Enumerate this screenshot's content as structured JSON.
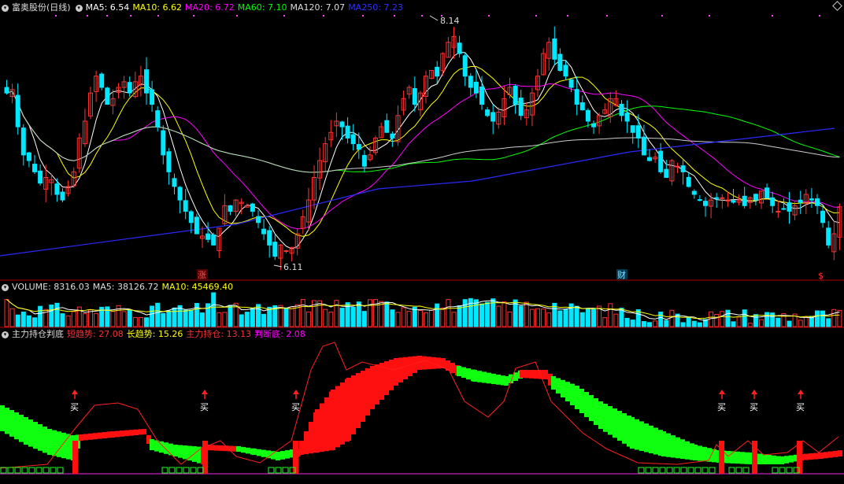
{
  "header": {
    "title": "富奥股份(日线)",
    "ma": [
      {
        "label": "MA5: 6.54",
        "color": "#ffffff"
      },
      {
        "label": "MA10: 6.62",
        "color": "#ffff00"
      },
      {
        "label": "MA20: 6.72",
        "color": "#ff00ff"
      },
      {
        "label": "MA60: 7.10",
        "color": "#00ff00"
      },
      {
        "label": "MA120: 7.07",
        "color": "#dddddd"
      },
      {
        "label": "MA250: 7.23",
        "color": "#3030ff"
      }
    ]
  },
  "volume_header": {
    "label": "VOLUME: 8316.03",
    "ma5": "MA5: 38126.72",
    "ma10": "MA10: 45469.40"
  },
  "indicator_header": {
    "title": "主力持仓判底",
    "items": [
      {
        "label": "短趋势: 27.08",
        "color": "#ff3030"
      },
      {
        "label": "长趋势: 15.26",
        "color": "#ffff00"
      },
      {
        "label": "主力持仓: 13.13",
        "color": "#ff3030"
      },
      {
        "label": "判断底: 2.08",
        "color": "#ff00ff"
      }
    ]
  },
  "annotations": {
    "high": "8.14",
    "low": "6.11",
    "marker_zhang": "涨",
    "marker_cai": "财",
    "marker_dollar": "$",
    "buy": "买"
  },
  "colors": {
    "up": "#ff3232",
    "down": "#00e8ff",
    "bull": "#ff1010",
    "bear": "#10ff10"
  },
  "chart_data": {
    "type": "candlestick",
    "price_range": [
      6.11,
      8.14
    ],
    "closes": [
      7.55,
      7.58,
      7.25,
      7.0,
      6.95,
      6.85,
      6.75,
      6.8,
      6.78,
      6.65,
      6.6,
      6.72,
      6.85,
      7.15,
      7.3,
      7.55,
      7.7,
      7.6,
      7.45,
      7.5,
      7.6,
      7.65,
      7.55,
      7.65,
      7.7,
      7.55,
      7.45,
      7.25,
      7.0,
      6.85,
      6.72,
      6.6,
      6.5,
      6.4,
      6.3,
      6.28,
      6.25,
      6.2,
      6.35,
      6.55,
      6.5,
      6.6,
      6.58,
      6.55,
      6.5,
      6.4,
      6.3,
      6.2,
      6.1,
      6.2,
      6.15,
      6.18,
      6.3,
      6.45,
      6.6,
      6.8,
      6.95,
      7.1,
      7.2,
      7.3,
      7.25,
      7.15,
      7.1,
      7.05,
      6.9,
      7.0,
      7.15,
      7.25,
      7.2,
      7.15,
      7.35,
      7.5,
      7.6,
      7.45,
      7.55,
      7.7,
      7.75,
      7.7,
      7.9,
      8.0,
      8.05,
      7.9,
      7.7,
      7.6,
      7.55,
      7.45,
      7.35,
      7.3,
      7.38,
      7.5,
      7.6,
      7.45,
      7.35,
      7.4,
      7.55,
      7.7,
      7.9,
      8.0,
      7.85,
      7.75,
      7.7,
      7.6,
      7.45,
      7.4,
      7.3,
      7.25,
      7.35,
      7.4,
      7.5,
      7.5,
      7.35,
      7.3,
      7.2,
      7.15,
      7.0,
      6.95,
      6.98,
      6.85,
      6.8,
      6.95,
      6.9,
      6.85,
      6.72,
      6.65,
      6.6,
      6.55,
      6.6,
      6.62,
      6.62,
      6.6,
      6.58,
      6.6,
      6.55,
      6.62,
      6.6,
      6.68,
      6.62,
      6.55,
      6.5,
      6.52,
      6.5,
      6.55,
      6.58,
      6.65,
      6.6,
      6.55,
      6.4,
      6.2,
      6.3,
      6.54
    ],
    "volume_header_value": 8316.03
  }
}
